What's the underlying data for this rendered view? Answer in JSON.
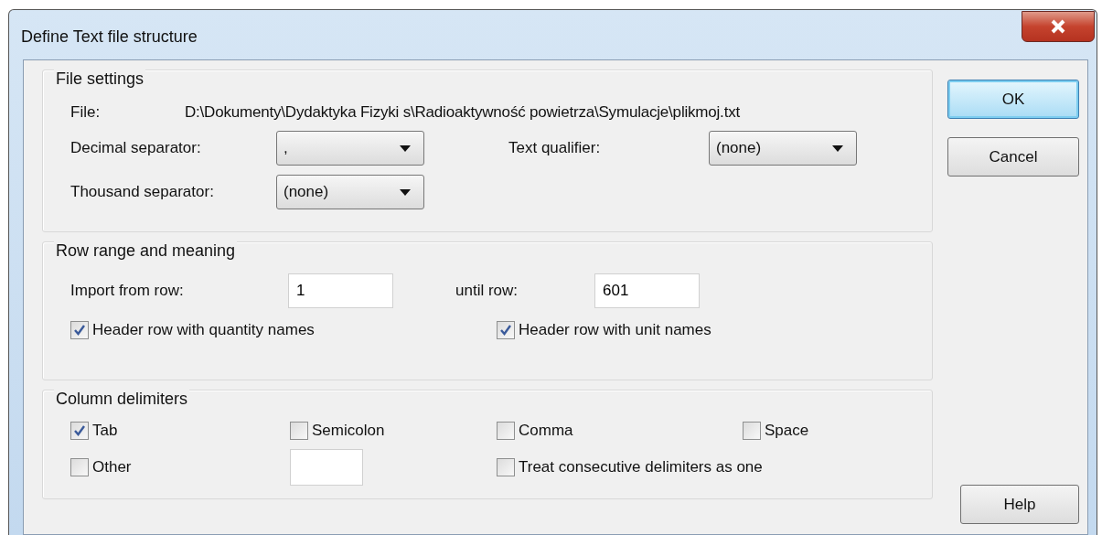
{
  "window": {
    "title": "Define Text file structure"
  },
  "file_settings": {
    "title": "File settings",
    "file_label": "File:",
    "file_path": "D:\\Dokumenty\\Dydaktyka Fizyki s\\Radioaktywność powietrza\\Symulacje\\plikmoj.txt",
    "decimal_separator": {
      "label": "Decimal separator:",
      "value": ","
    },
    "text_qualifier": {
      "label": "Text qualifier:",
      "value": "(none)"
    },
    "thousand_separator": {
      "label": "Thousand separator:",
      "value": "(none)"
    }
  },
  "row_range": {
    "title": "Row range and meaning",
    "import_from": {
      "label": "Import from row:",
      "value": "1"
    },
    "until": {
      "label": "until row:",
      "value": "601"
    },
    "checkboxes": [
      {
        "label": "Header row with quantity names",
        "checked": true
      },
      {
        "label": "Header row with unit names",
        "checked": true
      }
    ]
  },
  "column_delimiters": {
    "title": "Column delimiters",
    "rows": [
      [
        {
          "kind": "checkbox",
          "label": "Tab",
          "checked": true
        },
        {
          "kind": "checkbox",
          "label": "Semicolon",
          "checked": false
        },
        {
          "kind": "checkbox",
          "label": "Comma",
          "checked": false
        },
        {
          "kind": "checkbox",
          "label": "Space",
          "checked": false
        }
      ],
      [
        {
          "kind": "checkbox",
          "label": "Other",
          "checked": false
        },
        {
          "kind": "field"
        },
        {
          "kind": "checkbox",
          "label": "Treat consecutive delimiters as one",
          "checked": false
        }
      ]
    ]
  },
  "buttons": [
    {
      "label": "OK",
      "default": true
    },
    {
      "label": "Cancel",
      "default": false
    },
    {
      "label": "Help",
      "default": false
    }
  ]
}
